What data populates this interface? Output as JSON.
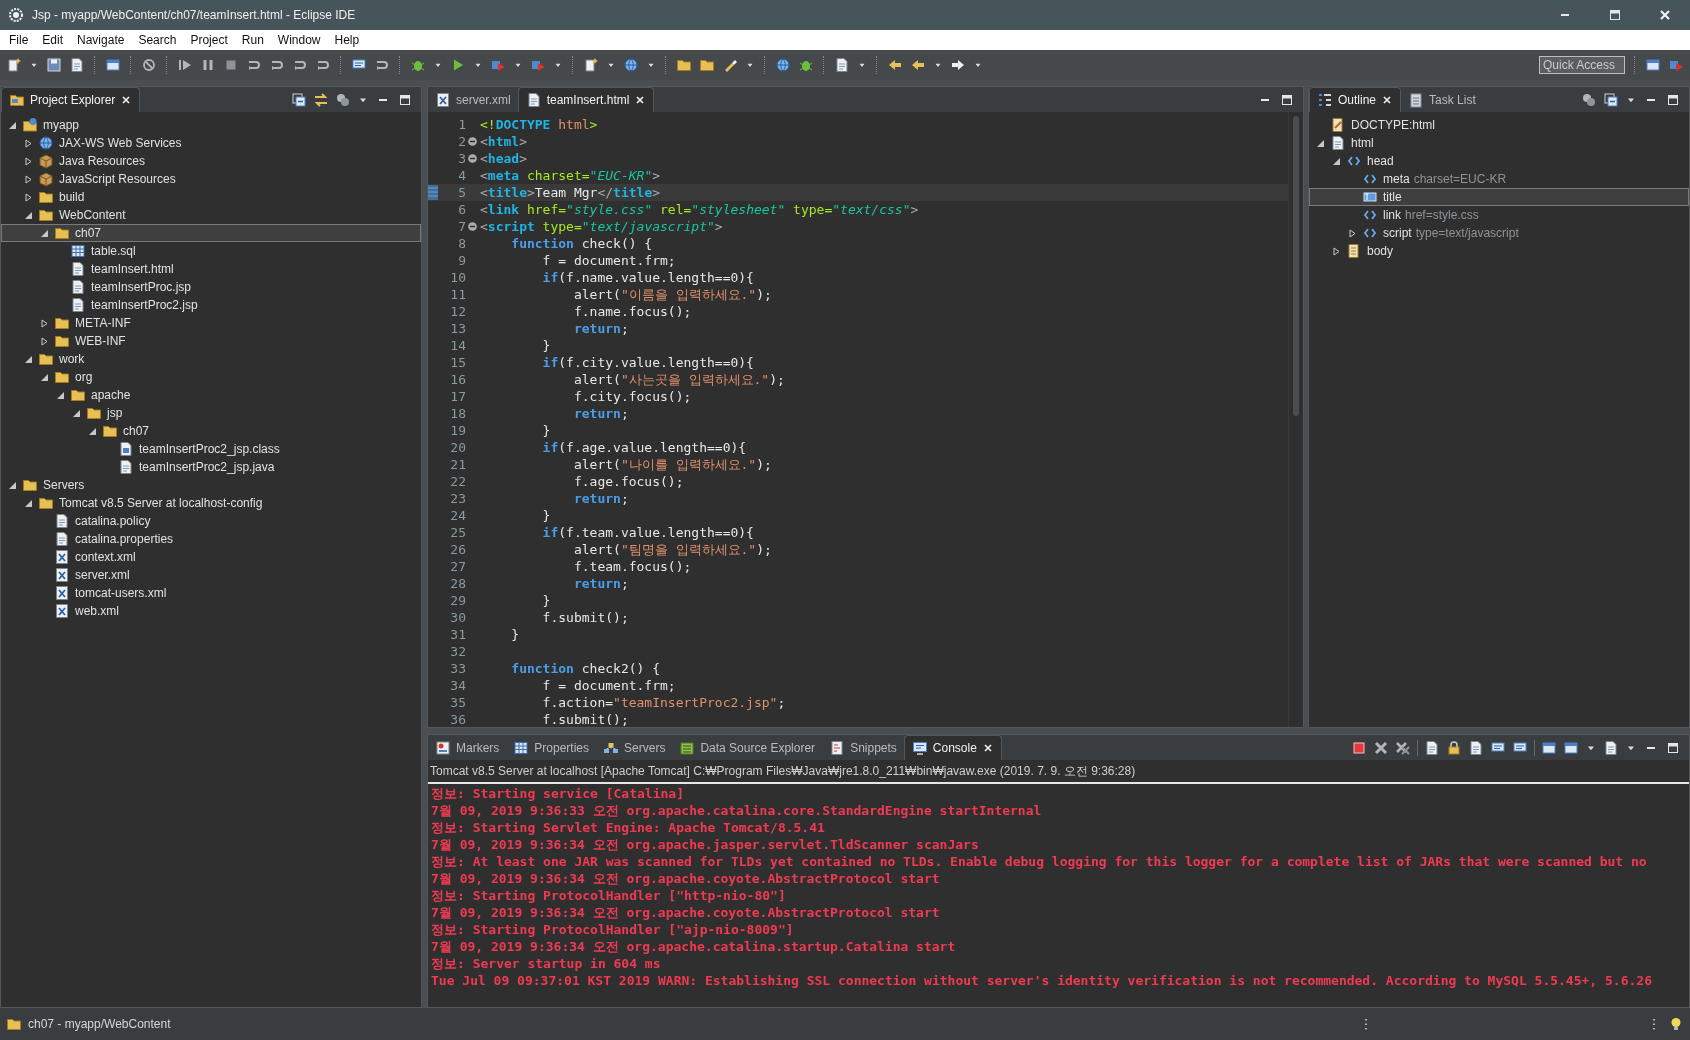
{
  "window": {
    "title": "Jsp - myapp/WebContent/ch07/teamInsert.html - Eclipse IDE"
  },
  "menu": [
    "File",
    "Edit",
    "Navigate",
    "Search",
    "Project",
    "Run",
    "Window",
    "Help"
  ],
  "toolbar": {
    "quick_access": {
      "placeholder": "Quick Access"
    }
  },
  "explorer": {
    "tabs": [
      {
        "label": "Project Explorer",
        "kind": "explorer",
        "selected": true
      }
    ],
    "tree": [
      {
        "label": "myapp",
        "kind": "project",
        "expanded": true,
        "selected": false,
        "children": [
          {
            "label": "JAX-WS Web Services",
            "kind": "services",
            "expanded": false,
            "selected": false
          },
          {
            "label": "Java Resources",
            "kind": "package",
            "expanded": false,
            "selected": false
          },
          {
            "label": "JavaScript Resources",
            "kind": "package",
            "expanded": false,
            "selected": false
          },
          {
            "label": "build",
            "kind": "folder",
            "expanded": false,
            "selected": false
          },
          {
            "label": "WebContent",
            "kind": "folder",
            "expanded": true,
            "selected": false,
            "children": [
              {
                "label": "ch07",
                "kind": "folder",
                "expanded": true,
                "selected": true,
                "children": [
                  {
                    "label": "table.sql",
                    "kind": "table",
                    "selected": false
                  },
                  {
                    "label": "teamInsert.html",
                    "kind": "file",
                    "selected": false
                  },
                  {
                    "label": "teamInsertProc.jsp",
                    "kind": "file",
                    "selected": false
                  },
                  {
                    "label": "teamInsertProc2.jsp",
                    "kind": "file",
                    "selected": false
                  }
                ]
              },
              {
                "label": "META-INF",
                "kind": "folder",
                "expanded": false,
                "selected": false
              },
              {
                "label": "WEB-INF",
                "kind": "folder",
                "expanded": false,
                "selected": false
              }
            ]
          },
          {
            "label": "work",
            "kind": "folder",
            "expanded": true,
            "selected": false,
            "children": [
              {
                "label": "org",
                "kind": "folder",
                "expanded": true,
                "selected": false,
                "children": [
                  {
                    "label": "apache",
                    "kind": "folder",
                    "expanded": true,
                    "selected": false,
                    "children": [
                      {
                        "label": "jsp",
                        "kind": "folder",
                        "expanded": true,
                        "selected": false,
                        "children": [
                          {
                            "label": "ch07",
                            "kind": "folder",
                            "expanded": true,
                            "selected": false,
                            "children": [
                              {
                                "label": "teamInsertProc2_jsp.class",
                                "kind": "class",
                                "selected": false
                              },
                              {
                                "label": "teamInsertProc2_jsp.java",
                                "kind": "file",
                                "selected": false
                              }
                            ]
                          }
                        ]
                      }
                    ]
                  }
                ]
              }
            ]
          }
        ]
      },
      {
        "label": "Servers",
        "kind": "folder",
        "expanded": true,
        "selected": false,
        "children": [
          {
            "label": "Tomcat v8.5 Server at localhost-config",
            "kind": "folder",
            "expanded": true,
            "selected": false,
            "children": [
              {
                "label": "catalina.policy",
                "kind": "file",
                "selected": false
              },
              {
                "label": "catalina.properties",
                "kind": "file",
                "selected": false
              },
              {
                "label": "context.xml",
                "kind": "xml",
                "selected": false
              },
              {
                "label": "server.xml",
                "kind": "xml",
                "selected": false
              },
              {
                "label": "tomcat-users.xml",
                "kind": "xml",
                "selected": false
              },
              {
                "label": "web.xml",
                "kind": "xml",
                "selected": false
              }
            ]
          }
        ]
      }
    ]
  },
  "editor": {
    "tabs": [
      {
        "label": "server.xml",
        "kind": "xml",
        "selected": false
      },
      {
        "label": "teamInsert.html",
        "kind": "file",
        "selected": true
      }
    ],
    "lines": [
      {
        "number": "1",
        "fold": false,
        "current": false,
        "tokens": [
          {
            "kind": "doctype",
            "text": "<!"
          },
          {
            "kind": "tag",
            "text": "DOCTYPE"
          },
          {
            "kind": "string",
            "text": " html"
          },
          {
            "kind": "doctype",
            "text": ">"
          }
        ]
      },
      {
        "number": "2",
        "fold": true,
        "current": false,
        "tokens": [
          {
            "kind": "bracket",
            "text": "<"
          },
          {
            "kind": "tag",
            "text": "html"
          },
          {
            "kind": "bracket",
            "text": ">"
          }
        ]
      },
      {
        "number": "3",
        "fold": true,
        "current": false,
        "tokens": [
          {
            "kind": "bracket",
            "text": "<"
          },
          {
            "kind": "tag",
            "text": "head"
          },
          {
            "kind": "bracket",
            "text": ">"
          }
        ]
      },
      {
        "number": "4",
        "fold": false,
        "current": false,
        "tokens": [
          {
            "kind": "bracket",
            "text": "<"
          },
          {
            "kind": "tag",
            "text": "meta"
          },
          {
            "kind": "attr",
            "text": " charset="
          },
          {
            "kind": "value",
            "text": "\"EUC-KR\""
          },
          {
            "kind": "bracket",
            "text": ">"
          }
        ]
      },
      {
        "number": "5",
        "fold": false,
        "current": true,
        "tokens": [
          {
            "kind": "bracket",
            "text": "<"
          },
          {
            "kind": "tag",
            "text": "title"
          },
          {
            "kind": "bracket",
            "text": ">"
          },
          {
            "kind": "plain",
            "text": "Team Mgr"
          },
          {
            "kind": "bracket",
            "text": "</"
          },
          {
            "kind": "tag",
            "text": "title"
          },
          {
            "kind": "bracket",
            "text": ">"
          }
        ]
      },
      {
        "number": "6",
        "fold": false,
        "current": false,
        "tokens": [
          {
            "kind": "bracket",
            "text": "<"
          },
          {
            "kind": "tag",
            "text": "link"
          },
          {
            "kind": "attr",
            "text": " href="
          },
          {
            "kind": "value",
            "text": "\"style.css\""
          },
          {
            "kind": "attr",
            "text": " rel="
          },
          {
            "kind": "value",
            "text": "\"stylesheet\""
          },
          {
            "kind": "attr",
            "text": " type="
          },
          {
            "kind": "value",
            "text": "\"text/css\""
          },
          {
            "kind": "bracket",
            "text": ">"
          }
        ]
      },
      {
        "number": "7",
        "fold": true,
        "current": false,
        "tokens": [
          {
            "kind": "bracket",
            "text": "<"
          },
          {
            "kind": "tag",
            "text": "script"
          },
          {
            "kind": "attr",
            "text": " type="
          },
          {
            "kind": "value",
            "text": "\"text/javascript\""
          },
          {
            "kind": "bracket",
            "text": ">"
          }
        ]
      },
      {
        "number": "8",
        "fold": false,
        "current": false,
        "tokens": [
          {
            "kind": "keyword",
            "text": "    function"
          },
          {
            "kind": "plain",
            "text": " check() {"
          }
        ]
      },
      {
        "number": "9",
        "fold": false,
        "current": false,
        "tokens": [
          {
            "kind": "plain",
            "text": "        f = document.frm;"
          }
        ]
      },
      {
        "number": "10",
        "fold": false,
        "current": false,
        "tokens": [
          {
            "kind": "keyword",
            "text": "        if"
          },
          {
            "kind": "plain",
            "text": "(f.name.value.length==0){"
          }
        ]
      },
      {
        "number": "11",
        "fold": false,
        "current": false,
        "tokens": [
          {
            "kind": "plain",
            "text": "            alert("
          },
          {
            "kind": "string",
            "text": "\"이름을 입력하세요.\""
          },
          {
            "kind": "plain",
            "text": ");"
          }
        ]
      },
      {
        "number": "12",
        "fold": false,
        "current": false,
        "tokens": [
          {
            "kind": "plain",
            "text": "            f.name.focus();"
          }
        ]
      },
      {
        "number": "13",
        "fold": false,
        "current": false,
        "tokens": [
          {
            "kind": "keyword",
            "text": "            return"
          },
          {
            "kind": "plain",
            "text": ";"
          }
        ]
      },
      {
        "number": "14",
        "fold": false,
        "current": false,
        "tokens": [
          {
            "kind": "plain",
            "text": "        }"
          }
        ]
      },
      {
        "number": "15",
        "fold": false,
        "current": false,
        "tokens": [
          {
            "kind": "keyword",
            "text": "        if"
          },
          {
            "kind": "plain",
            "text": "(f.city.value.length==0){"
          }
        ]
      },
      {
        "number": "16",
        "fold": false,
        "current": false,
        "tokens": [
          {
            "kind": "plain",
            "text": "            alert("
          },
          {
            "kind": "string",
            "text": "\"사는곳을 입력하세요.\""
          },
          {
            "kind": "plain",
            "text": ");"
          }
        ]
      },
      {
        "number": "17",
        "fold": false,
        "current": false,
        "tokens": [
          {
            "kind": "plain",
            "text": "            f.city.focus();"
          }
        ]
      },
      {
        "number": "18",
        "fold": false,
        "current": false,
        "tokens": [
          {
            "kind": "keyword",
            "text": "            return"
          },
          {
            "kind": "plain",
            "text": ";"
          }
        ]
      },
      {
        "number": "19",
        "fold": false,
        "current": false,
        "tokens": [
          {
            "kind": "plain",
            "text": "        }"
          }
        ]
      },
      {
        "number": "20",
        "fold": false,
        "current": false,
        "tokens": [
          {
            "kind": "keyword",
            "text": "        if"
          },
          {
            "kind": "plain",
            "text": "(f.age.value.length==0){"
          }
        ]
      },
      {
        "number": "21",
        "fold": false,
        "current": false,
        "tokens": [
          {
            "kind": "plain",
            "text": "            alert("
          },
          {
            "kind": "string",
            "text": "\"나이를 입력하세요.\""
          },
          {
            "kind": "plain",
            "text": ");"
          }
        ]
      },
      {
        "number": "22",
        "fold": false,
        "current": false,
        "tokens": [
          {
            "kind": "plain",
            "text": "            f.age.focus();"
          }
        ]
      },
      {
        "number": "23",
        "fold": false,
        "current": false,
        "tokens": [
          {
            "kind": "keyword",
            "text": "            return"
          },
          {
            "kind": "plain",
            "text": ";"
          }
        ]
      },
      {
        "number": "24",
        "fold": false,
        "current": false,
        "tokens": [
          {
            "kind": "plain",
            "text": "        }"
          }
        ]
      },
      {
        "number": "25",
        "fold": false,
        "current": false,
        "tokens": [
          {
            "kind": "keyword",
            "text": "        if"
          },
          {
            "kind": "plain",
            "text": "(f.team.value.length==0){"
          }
        ]
      },
      {
        "number": "26",
        "fold": false,
        "current": false,
        "tokens": [
          {
            "kind": "plain",
            "text": "            alert("
          },
          {
            "kind": "string",
            "text": "\"팀명을 입력하세요.\""
          },
          {
            "kind": "plain",
            "text": ");"
          }
        ]
      },
      {
        "number": "27",
        "fold": false,
        "current": false,
        "tokens": [
          {
            "kind": "plain",
            "text": "            f.team.focus();"
          }
        ]
      },
      {
        "number": "28",
        "fold": false,
        "current": false,
        "tokens": [
          {
            "kind": "keyword",
            "text": "            return"
          },
          {
            "kind": "plain",
            "text": ";"
          }
        ]
      },
      {
        "number": "29",
        "fold": false,
        "current": false,
        "tokens": [
          {
            "kind": "plain",
            "text": "        }"
          }
        ]
      },
      {
        "number": "30",
        "fold": false,
        "current": false,
        "tokens": [
          {
            "kind": "plain",
            "text": "        f.submit();"
          }
        ]
      },
      {
        "number": "31",
        "fold": false,
        "current": false,
        "tokens": [
          {
            "kind": "plain",
            "text": "    }"
          }
        ]
      },
      {
        "number": "32",
        "fold": false,
        "current": false
      },
      {
        "number": "33",
        "fold": false,
        "current": false,
        "tokens": [
          {
            "kind": "keyword",
            "text": "    function"
          },
          {
            "kind": "plain",
            "text": " check2() {"
          }
        ]
      },
      {
        "number": "34",
        "fold": false,
        "current": false,
        "tokens": [
          {
            "kind": "plain",
            "text": "        f = document.frm;"
          }
        ]
      },
      {
        "number": "35",
        "fold": false,
        "current": false,
        "tokens": [
          {
            "kind": "plain",
            "text": "        f.action="
          },
          {
            "kind": "string",
            "text": "\"teamInsertProc2.jsp\""
          },
          {
            "kind": "plain",
            "text": ";"
          }
        ]
      },
      {
        "number": "36",
        "fold": false,
        "current": false,
        "tokens": [
          {
            "kind": "plain",
            "text": "        f.submit();"
          }
        ]
      }
    ]
  },
  "outline": {
    "tabs": [
      {
        "label": "Outline",
        "kind": "outline",
        "selected": true
      },
      {
        "label": "Task List",
        "kind": "tasks",
        "selected": false
      }
    ],
    "tree": [
      {
        "label": "DOCTYPE:html",
        "kind": "doctype",
        "selected": false
      },
      {
        "label": "html",
        "kind": "page",
        "expanded": true,
        "selected": false,
        "children": [
          {
            "label": "head",
            "kind": "element",
            "expanded": true,
            "selected": false,
            "children": [
              {
                "label": "meta",
                "detail": "charset=EUC-KR",
                "kind": "element",
                "selected": false
              },
              {
                "label": "title",
                "kind": "title",
                "selected": true
              },
              {
                "label": "link",
                "detail": "href=style.css",
                "kind": "element",
                "selected": false
              },
              {
                "label": "script",
                "detail": "type=text/javascript",
                "kind": "element",
                "expanded": false,
                "selected": false
              }
            ]
          },
          {
            "label": "body",
            "kind": "body",
            "expanded": false,
            "selected": false
          }
        ]
      }
    ]
  },
  "console": {
    "tabs": [
      {
        "label": "Markers",
        "kind": "markers",
        "selected": false
      },
      {
        "label": "Properties",
        "kind": "table",
        "selected": false
      },
      {
        "label": "Servers",
        "kind": "servers",
        "selected": false
      },
      {
        "label": "Data Source Explorer",
        "kind": "database",
        "selected": false
      },
      {
        "label": "Snippets",
        "kind": "snippets",
        "selected": false
      },
      {
        "label": "Console",
        "kind": "console",
        "selected": true
      }
    ],
    "info": "Tomcat v8.5 Server at localhost [Apache Tomcat] C:₩Program Files₩Java₩jre1.8.0_211₩bin₩javaw.exe (2019. 7. 9. 오전 9:36:28)",
    "output": [
      "정보: Starting service [Catalina]",
      "7월 09, 2019 9:36:33 오전 org.apache.catalina.core.StandardEngine startInternal",
      "정보: Starting Servlet Engine: Apache Tomcat/8.5.41",
      "7월 09, 2019 9:36:34 오전 org.apache.jasper.servlet.TldScanner scanJars",
      "정보: At least one JAR was scanned for TLDs yet contained no TLDs. Enable debug logging for this logger for a complete list of JARs that were scanned but no",
      "7월 09, 2019 9:36:34 오전 org.apache.coyote.AbstractProtocol start",
      "정보: Starting ProtocolHandler [\"http-nio-80\"]",
      "7월 09, 2019 9:36:34 오전 org.apache.coyote.AbstractProtocol start",
      "정보: Starting ProtocolHandler [\"ajp-nio-8009\"]",
      "7월 09, 2019 9:36:34 오전 org.apache.catalina.startup.Catalina start",
      "정보: Server startup in 604 ms",
      "Tue Jul 09 09:37:01 KST 2019 WARN: Establishing SSL connection without server's identity verification is not recommended. According to MySQL 5.5.45+, 5.6.26"
    ]
  },
  "status_bar": {
    "text": "ch07 - myapp/WebContent"
  }
}
